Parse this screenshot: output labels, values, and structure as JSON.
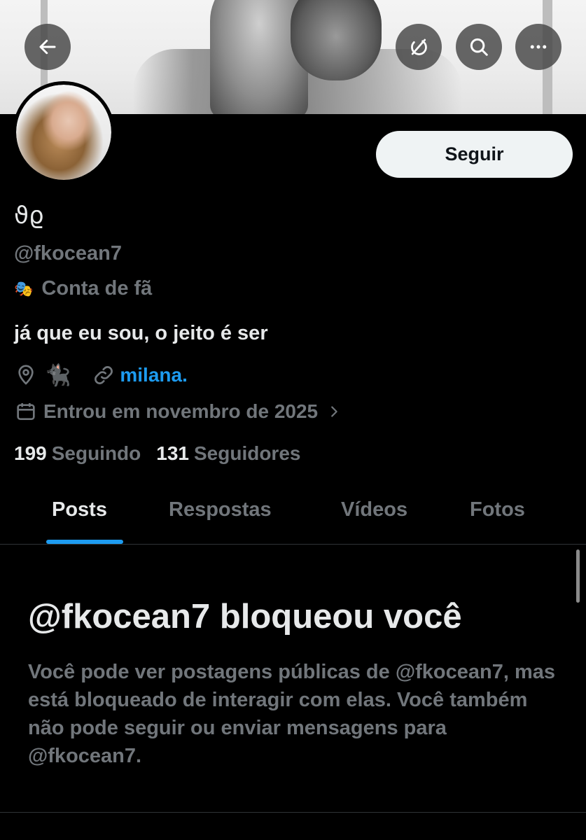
{
  "profile": {
    "display_name": "ϑϱ",
    "handle": "@fkocean7",
    "label_icon": "🎭",
    "label": "Conta de fã",
    "bio": "já que eu sou, o jeito é ser",
    "location_emoji": "🐈‍⬛",
    "website": "milana.",
    "joined": "Entrou em novembro de 2025"
  },
  "follow_button": "Seguir",
  "stats": {
    "following_count": "199",
    "following_label": "Seguindo",
    "followers_count": "131",
    "followers_label": "Seguidores"
  },
  "tabs": [
    {
      "label": "Posts",
      "active": true
    },
    {
      "label": "Respostas",
      "active": false
    },
    {
      "label": "Vídeos",
      "active": false
    },
    {
      "label": "Fotos",
      "active": false
    }
  ],
  "blocked": {
    "title": "@fkocean7 bloqueou você",
    "body": "Você pode ver postagens públicas de @fkocean7, mas está bloqueado de interagir com elas. Você também não pode seguir ou enviar mensagens para @fkocean7."
  },
  "icons": {
    "back": "arrow-left-icon",
    "grok": "grok-icon",
    "search": "search-icon",
    "more": "more-icon",
    "location": "location-pin-icon",
    "link": "link-icon",
    "calendar": "calendar-icon",
    "chevron": "chevron-right-icon"
  },
  "colors": {
    "background": "#000000",
    "accent": "#1d9bf0",
    "secondary_text": "#71767b",
    "primary_text": "#e7e9ea",
    "button_bg": "#eff3f4"
  }
}
